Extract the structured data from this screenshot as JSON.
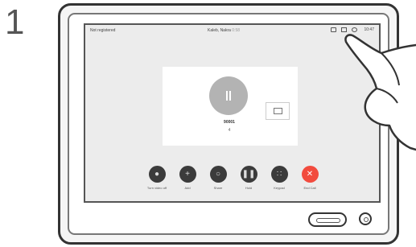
{
  "step": {
    "number": "1"
  },
  "statusbar": {
    "left_label": "Not registered",
    "call_name": "Kaleb, Nakra",
    "call_time": "0:58",
    "clock": "10:47",
    "icons": [
      "camera-icon",
      "layout-icon",
      "phone-icon"
    ]
  },
  "call": {
    "caller_name": "90001",
    "caller_sub": "4",
    "status_icon": "pause-icon",
    "selfview_icon": "selfview-icon"
  },
  "controls": [
    {
      "label": "Turn video off",
      "icon": "video-off-icon"
    },
    {
      "label": "Add",
      "icon": "plus-icon"
    },
    {
      "label": "Share",
      "icon": "share-icon"
    },
    {
      "label": "Hold",
      "icon": "pause-icon"
    },
    {
      "label": "Keypad",
      "icon": "keypad-icon"
    },
    {
      "label": "End Call",
      "icon": "end-call-icon"
    }
  ],
  "colors": {
    "end_call": "#f24b3e",
    "button": "#3b3b3b",
    "screen": "#ececec"
  }
}
